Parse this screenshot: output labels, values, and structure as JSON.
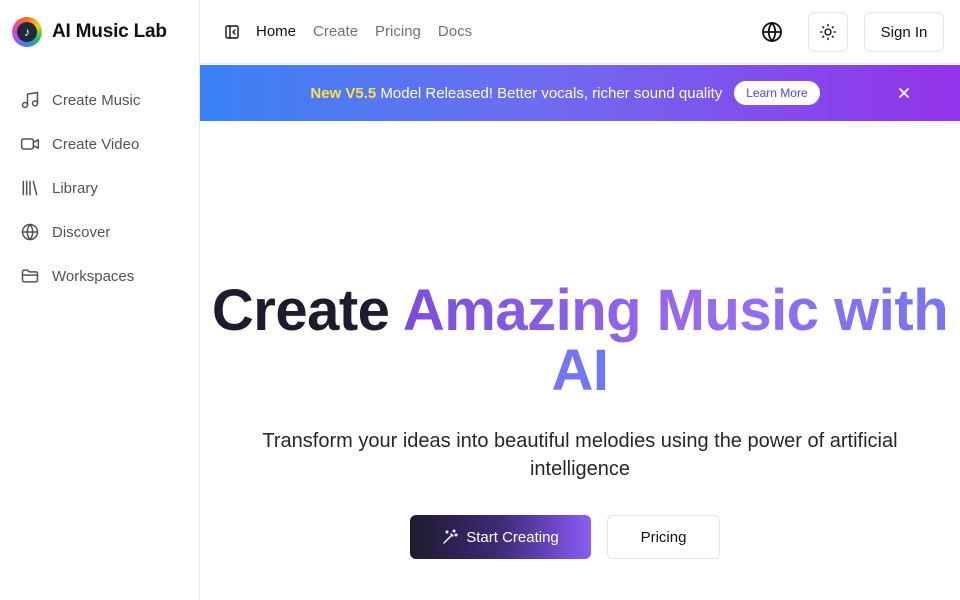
{
  "brand": {
    "name": "AI Music Lab",
    "logo_icon": "music-note-icon"
  },
  "sidebar": {
    "items": [
      {
        "label": "Create Music",
        "icon": "music-note-icon"
      },
      {
        "label": "Create Video",
        "icon": "video-camera-icon"
      },
      {
        "label": "Library",
        "icon": "library-icon"
      },
      {
        "label": "Discover",
        "icon": "globe-icon"
      },
      {
        "label": "Workspaces",
        "icon": "folder-icon"
      }
    ]
  },
  "header": {
    "links": [
      "Home",
      "Create",
      "Pricing",
      "Docs"
    ],
    "active_link": "Home",
    "sign_in_label": "Sign In"
  },
  "banner": {
    "highlight": "New V5.5",
    "text": " Model Released! Better vocals, richer sound quality",
    "button_label": "Learn More"
  },
  "hero": {
    "title_dark": "Create ",
    "title_gradient": "Amazing Music with AI",
    "subtitle": "Transform your ideas into beautiful melodies using the power of artificial intelligence",
    "primary_button": "Start Creating",
    "secondary_button": "Pricing"
  },
  "colors": {
    "banner_start": "#3b82f6",
    "banner_end": "#9333ea",
    "banner_highlight": "#fde047",
    "accent_purple": "#8b5cf6",
    "title_dark": "#1f1b2e"
  }
}
